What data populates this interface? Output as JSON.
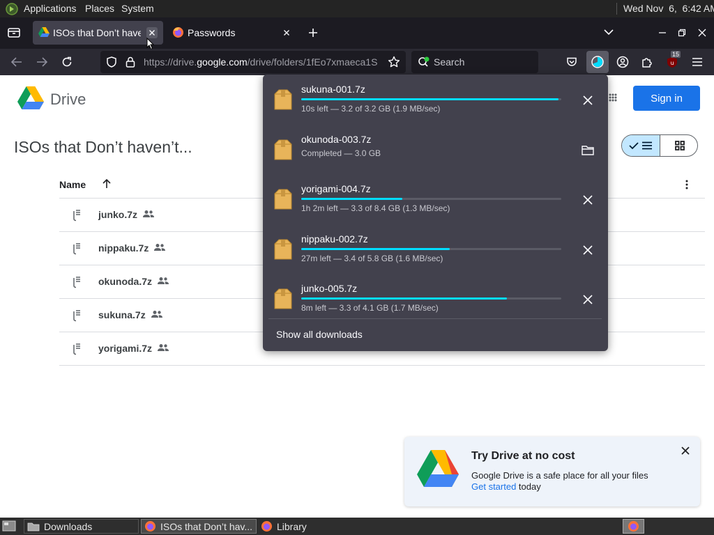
{
  "top_panel": {
    "menus": [
      "Applications",
      "Places",
      "System"
    ],
    "clock": "Wed Nov  6,  6:42 AM"
  },
  "tabs": [
    {
      "title": "ISOs that Don’t haven’t",
      "active": true,
      "icon": "google-drive-icon"
    },
    {
      "title": "Passwords",
      "active": false,
      "icon": "firefox-icon"
    }
  ],
  "nav": {
    "url_prefix": "https://drive.",
    "url_domain": "google.com",
    "url_rest": "/drive/folders/1fEo7xmaeca1S",
    "search_placeholder": "Search",
    "extension_badge": "15"
  },
  "drive": {
    "brand": "Drive",
    "sign_in": "Sign in",
    "folder_title": "ISOs that Don’t haven’t...",
    "column_name": "Name",
    "files": [
      {
        "name": "junko.7z"
      },
      {
        "name": "nippaku.7z"
      },
      {
        "name": "okunoda.7z"
      },
      {
        "name": "sukuna.7z"
      },
      {
        "name": "yorigami.7z"
      }
    ]
  },
  "downloads": {
    "items": [
      {
        "name": "sukuna-001.7z",
        "status": "10s left — 3.2 of 3.2 GB (1.9 MB/sec)",
        "progress": 0.99,
        "completed": false
      },
      {
        "name": "okunoda-003.7z",
        "status": "Completed — 3.0 GB",
        "progress": 1.0,
        "completed": true
      },
      {
        "name": "yorigami-004.7z",
        "status": "1h 2m left — 3.3 of 8.4 GB (1.3 MB/sec)",
        "progress": 0.39,
        "completed": false
      },
      {
        "name": "nippaku-002.7z",
        "status": "27m left — 3.4 of 5.8 GB (1.6 MB/sec)",
        "progress": 0.57,
        "completed": false
      },
      {
        "name": "junko-005.7z",
        "status": "8m left — 3.3 of 4.1 GB (1.7 MB/sec)",
        "progress": 0.79,
        "completed": false
      }
    ],
    "show_all": "Show all downloads"
  },
  "promo": {
    "title": "Try Drive at no cost",
    "text": "Google Drive is a safe place for all your files",
    "link": "Get started",
    "after_link": " today"
  },
  "taskbar": {
    "items": [
      "Downloads",
      "ISOs that Don’t hav...",
      "Library"
    ]
  },
  "colors": {
    "accent": "#00ddff",
    "sign_in": "#1a73e8",
    "panel": "#42414d"
  }
}
